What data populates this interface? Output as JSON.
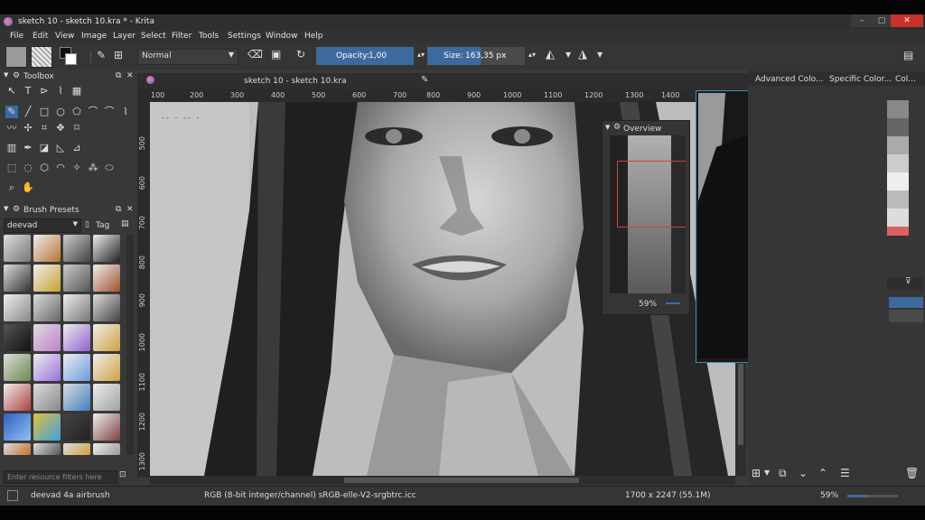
{
  "window": {
    "title": "sketch 10 - sketch 10.kra * - Krita",
    "controls": [
      "–",
      "▢",
      "✕"
    ]
  },
  "menu": [
    "File",
    "Edit",
    "View",
    "Image",
    "Layer",
    "Select",
    "Filter",
    "Tools",
    "Settings",
    "Window",
    "Help"
  ],
  "toolbar": {
    "blend_mode": "Normal",
    "opacity_label": "Opacity:",
    "opacity_value": "1,00",
    "size_label": "Size:",
    "size_value": "163,35 px"
  },
  "toolbox": {
    "title": "Toolbox"
  },
  "brush_presets": {
    "title": "Brush Presets",
    "tag_value": "deevad",
    "tag_button": "Tag",
    "filter_placeholder": "Enter resource filters here"
  },
  "document_tab": {
    "title": "sketch 10 - sketch 10.kra"
  },
  "ruler": {
    "h_ticks": [
      "100",
      "200",
      "300",
      "400",
      "500",
      "600",
      "700",
      "800",
      "900",
      "1000",
      "1100",
      "1200",
      "1300",
      "1400"
    ],
    "v_ticks": [
      "500",
      "600",
      "700",
      "800",
      "900",
      "1000",
      "1100",
      "1200",
      "1300"
    ]
  },
  "overview": {
    "title": "Overview",
    "zoom": "59%"
  },
  "right_tabs": [
    "Advanced Colo...",
    "Specific Color...",
    "Col..."
  ],
  "status": {
    "brush_name": "deevad 4a airbrush",
    "color_space": "RGB (8-bit integer/channel)  sRGB-elle-V2-srgbtrc.icc",
    "dimensions": "1700 x 2247 (55.1M)",
    "zoom": "59%"
  },
  "colors": {
    "accent_blue": "#3d6a9e",
    "window_bg": "#353535"
  }
}
